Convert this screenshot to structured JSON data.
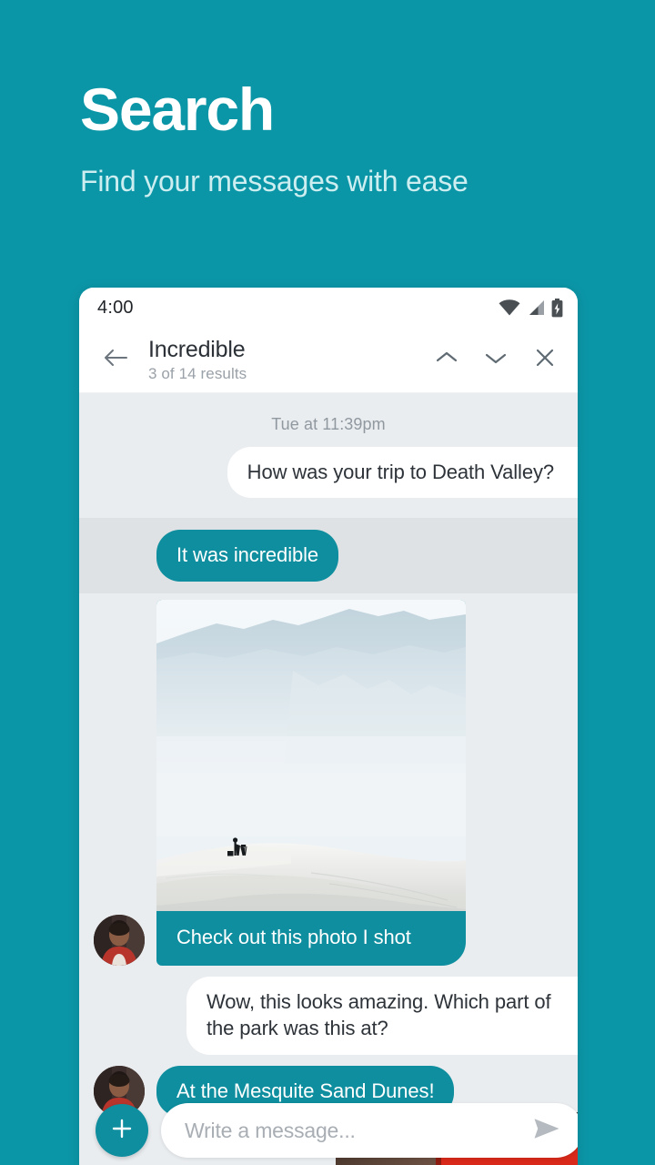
{
  "promo": {
    "title": "Search",
    "subtitle": "Find your messages with ease"
  },
  "colors": {
    "brand_teal": "#0b96a7",
    "bubble_teal": "#0e8e9e",
    "chat_background": "#eaedf0",
    "highlight_row": "#dfe2e4",
    "incoming_bubble": "#ffffff"
  },
  "statusbar": {
    "clock": "4:00",
    "icons": [
      "wifi-icon",
      "cell-signal-icon",
      "battery-charging-icon"
    ]
  },
  "search_header": {
    "back_icon": "arrow-left-icon",
    "query": "Incredible",
    "result_count": "3 of 14 results",
    "prev_icon": "chevron-up-icon",
    "next_icon": "chevron-down-icon",
    "close_icon": "close-icon"
  },
  "chat": {
    "daystamp": "Tue at 11:39pm",
    "messages": [
      {
        "id": "m1",
        "direction": "incoming",
        "text": "How was your trip to Death Valley?",
        "highlighted": false
      },
      {
        "id": "m2",
        "direction": "outgoing",
        "text": "It was incredible",
        "highlighted": true
      },
      {
        "id": "m3",
        "direction": "outgoing",
        "text": "Check out this photo I shot",
        "attachment": "desert-dunes-photo",
        "highlighted": false
      },
      {
        "id": "m4",
        "direction": "incoming",
        "text": "Wow, this looks amazing. Which part of the park was this at?",
        "highlighted": false
      },
      {
        "id": "m5",
        "direction": "outgoing",
        "text": "At the Mesquite Sand Dunes!",
        "highlighted": false
      },
      {
        "id": "m6",
        "direction": "outgoing",
        "attachment": "brick-wall-photo",
        "text": "",
        "highlighted": false
      }
    ]
  },
  "composer": {
    "add_icon": "plus-icon",
    "placeholder": "Write a message...",
    "send_icon": "send-icon"
  }
}
